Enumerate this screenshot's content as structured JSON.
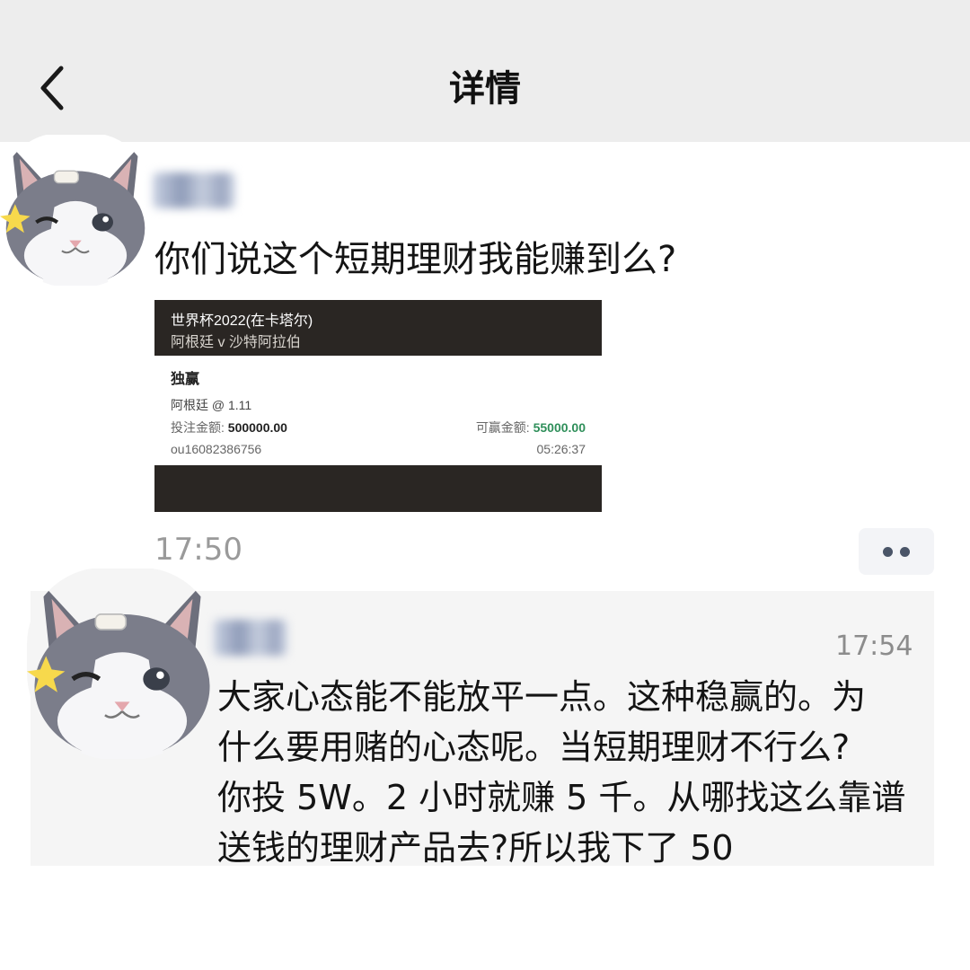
{
  "header": {
    "title": "详情",
    "back_icon": "chevron-left-icon"
  },
  "post": {
    "text": "你们说这个短期理财我能赚到么?",
    "time": "17:50",
    "more_icon": "more-dots-icon",
    "ticket": {
      "league": "世界杯2022(在卡塔尔)",
      "match": "阿根廷 v 沙特阿拉伯",
      "bet_type": "独赢",
      "pick": "阿根廷 @ 1.11",
      "stake_label": "投注金额:",
      "stake_value": "500000.00",
      "win_label": "可赢金额:",
      "win_value": "55000.00",
      "order_id": "ou16082386756",
      "order_time": "05:26:37"
    }
  },
  "comment": {
    "time": "17:54",
    "lines": [
      "大家心态能不能放平一点。这种稳赢的。为",
      "什么要用赌的心态呢。当短期理财不行么?",
      "你投 5W。2 小时就赚 5 千。从哪找这么靠谱",
      "送钱的理财产品去?所以我下了 50"
    ]
  },
  "colors": {
    "header_bg": "#ededed",
    "ticket_dark": "#2a2623",
    "win_green": "#2f8f5a",
    "comment_bg": "#f5f5f5"
  },
  "icons": [
    "chevron-left-icon",
    "cat-avatar",
    "more-dots-icon"
  ]
}
